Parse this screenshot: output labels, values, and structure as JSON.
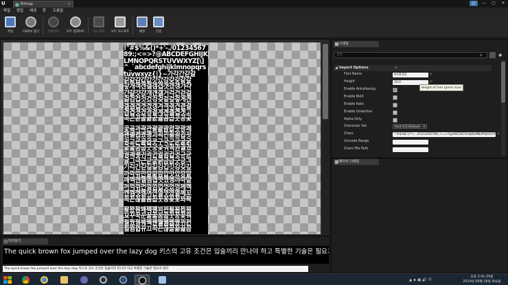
{
  "window": {
    "tab_title": "Bitmap",
    "close_icon": "×",
    "controls": {
      "min": "—",
      "max": "▢",
      "close": "✕"
    }
  },
  "menu": [
    "파일",
    "편집",
    "애셋",
    "창",
    "도움말"
  ],
  "toolbar": [
    {
      "label": "저장",
      "icon": "save-icon",
      "enabled": true
    },
    {
      "label": "CB에서 찾기",
      "icon": "browse-icon",
      "enabled": true
    },
    {
      "label": "업데이트",
      "icon": "update-icon",
      "enabled": false
    },
    {
      "label": "모두 업데이트",
      "icon": "update-all-icon",
      "enabled": true
    },
    {
      "label": "익스포트",
      "icon": "export-icon",
      "enabled": false
    },
    {
      "label": "모두 익스포트",
      "icon": "export-all-icon",
      "enabled": true
    },
    {
      "label": "배경",
      "icon": "background-icon",
      "enabled": true
    },
    {
      "label": "전경",
      "icon": "foreground-icon",
      "enabled": true
    }
  ],
  "font_atlas": {
    "lines": [
      "!\"#$%&()*+'-./01234567",
      "89:;<=>?@ABCDEFGHIJK",
      "LMNOPQRSTUVWXYZ[\\]",
      "^_`abcdefghijklmnopqrs",
      "tuvwxyz{|}~가각간갇갈",
      "갉갊감갑값갓갔강갖갗같갚",
      "갛개객갠갤갬갭갯갰갱갸갹",
      "갼걀걋걍걔걘걜거걱건걷걸",
      "걺검겁것겄겅겆겉겊겋게겐",
      "겔겜겝겟겠겡겨격겪견겯결",
      "겸겹겻겼경곁계곈곌곕곗고",
      "곡곤곧골곪곬곯곰곱곳공곶",
      "",
      "곷곸과곽관괄괆괌괍괏광괘",
      "괜괠괩괬괭괴괵괸괼굄굅굇",
      "굉교굔굘굡굣구국군굳굴굵",
      "굶굻굼굽굿궁궂궈궉권궐궜",
      "궝궤궷귀귁귄귈귐귑귓규균",
      "귤그극근귿글긁금급긋긍긔",
      "기긱긴긷길긺김깁깃깅깆깊",
      "까깍깎깐깔깖깜깝깟깠깡깥",
      "깨깩깬깰깸깹깻깼깽꺄꺅꺌",
      "꺼꺽꺾껀껄껌껍껏껐껑께껙",
      "껜껨껫껭껴껸껼꼇꼈꼍꼐꼬",
      "꼭꼰꼲꼴꼼꼽꼿꽁꽂꽃꽈꽉",
      "",
      "꽐꽜꽝꽤꽥꽹꾀꾄꾈꾐꾑꾕",
      "꾜꾸꾹꾼꿀꿇꿈꿉꿋꿍꿎꿔",
      "꿜꿨꿩꿰꿱꿴꿸뀀뀁뀄뀌뀐",
      "뀔뀜뀝뀨끄끅끈끊끌끎끓끔"
    ]
  },
  "details": {
    "tab_label": "디테일",
    "search_placeholder": "검색",
    "search_icon": "⌕",
    "eye_icon": "◉",
    "category": "Import Options",
    "category_reset": "↶",
    "properties": [
      {
        "label": "Font Name",
        "type": "text",
        "value": "HY견고딕",
        "reset": true
      },
      {
        "label": "Height",
        "type": "number",
        "value": "20.0",
        "reset": true
      },
      {
        "label": "Enable Antialiasing",
        "type": "checkbox",
        "checked": true
      },
      {
        "label": "Enable Bold",
        "type": "checkbox",
        "checked": false
      },
      {
        "label": "Enable Italic",
        "type": "checkbox",
        "checked": false
      },
      {
        "label": "Enable Underline",
        "type": "checkbox",
        "checked": false
      },
      {
        "label": "Alpha Only",
        "type": "checkbox",
        "checked": false
      },
      {
        "label": "Character Set",
        "type": "dropdown",
        "value": "Font ICS Default"
      },
      {
        "label": "Chars",
        "type": "text",
        "value": "!\"#$%&'()*+,-./0123456789:;<=>?@ABCDEFGHIJKLMNOPQRSTUVWXY",
        "reset": true
      },
      {
        "label": "Unicode Range",
        "type": "text",
        "value": ""
      },
      {
        "label": "Chars File Path",
        "type": "text",
        "value": ""
      }
    ],
    "tooltip": "Height of font (point size)"
  },
  "props_panel": {
    "tab_label": "페이지 디테일"
  },
  "preview": {
    "tab_label": "미리보기",
    "sample_text": "The quick brown fox jumped over the lazy dog 키스의 고유 조건은 입술끼리 만나야 하고 특별한 기술은 필요치",
    "input_value": "The quick brown fox jumped over the lazy dog 키스의 고유 조건은 입술끼리 만나야 하고 특별한 기술은 필요치 않다"
  },
  "taskbar": {
    "apps": [
      "chrome-icon",
      "ie-icon",
      "explorer-icon",
      "app-icon",
      "app2-icon",
      "unreal-icon",
      "unreal-active-icon",
      "notepad-icon"
    ],
    "tray": "▲ ◈ ▣ 🔊 가",
    "time": "오후 2:41:34분",
    "date": "2014년 06월 26일 목요일"
  },
  "colors": {
    "accent_warning": "#d2b24a",
    "panel_bg": "#1e1e1e",
    "viewport_checker_light": "#c6c6c6",
    "viewport_checker_dark": "#9d9d9d"
  }
}
